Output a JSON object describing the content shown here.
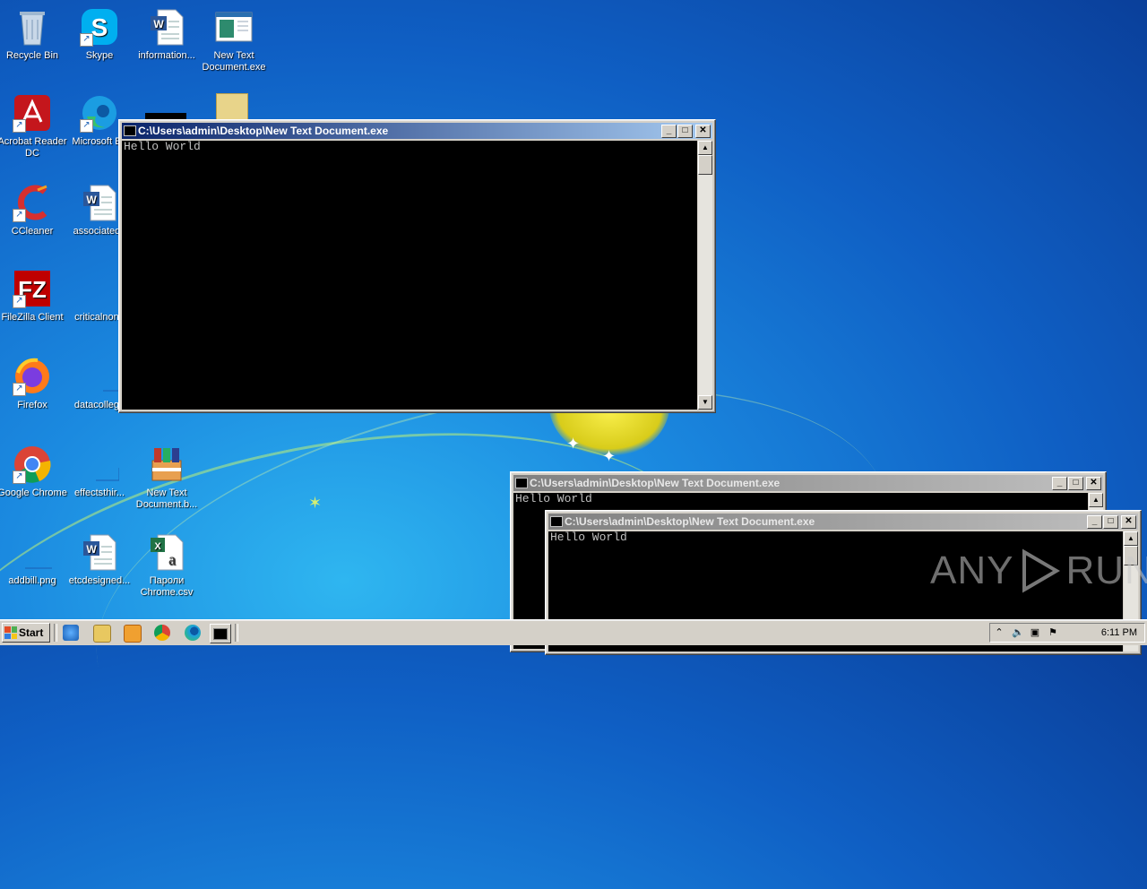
{
  "desktop": {
    "icons": [
      {
        "label": "Recycle Bin",
        "icon": "recycle-bin-icon"
      },
      {
        "label": "Skype",
        "icon": "skype-icon"
      },
      {
        "label": "information...",
        "icon": "word-document-icon"
      },
      {
        "label": "New Text Document.exe",
        "icon": "console-exe-icon"
      },
      {
        "label": "Acrobat Reader DC",
        "icon": "acrobat-icon"
      },
      {
        "label": "Microsoft Ed",
        "icon": "edge-icon"
      },
      {
        "label": "CCleaner",
        "icon": "ccleaner-icon"
      },
      {
        "label": "associateda",
        "icon": "word-document-icon"
      },
      {
        "label": "FileZilla Client",
        "icon": "filezilla-icon"
      },
      {
        "label": "criticalnone",
        "icon": "blank-file-icon"
      },
      {
        "label": "Firefox",
        "icon": "firefox-icon"
      },
      {
        "label": "datacollege",
        "icon": "blank-file-icon"
      },
      {
        "label": "Google Chrome",
        "icon": "chrome-icon"
      },
      {
        "label": "effectsthir...",
        "icon": "blank-file-icon"
      },
      {
        "label": "New Text Document.b...",
        "icon": "winrar-icon"
      },
      {
        "label": "addbill.png",
        "icon": "blank-file-icon"
      },
      {
        "label": "etcdesigned...",
        "icon": "word-document-icon"
      },
      {
        "label": "Пароли Chrome.csv",
        "icon": "excel-csv-icon"
      }
    ]
  },
  "windows": [
    {
      "title": "C:\\Users\\admin\\Desktop\\New Text Document.exe",
      "output": "Hello World",
      "state": "active"
    },
    {
      "title": "C:\\Users\\admin\\Desktop\\New Text Document.exe",
      "output": "Hello World",
      "state": "inactive"
    },
    {
      "title": "C:\\Users\\admin\\Desktop\\New Text Document.exe",
      "output": "Hello World",
      "state": "inactive"
    }
  ],
  "title_buttons": {
    "minimize": "_",
    "maximize": "□",
    "close": "✕"
  },
  "watermark": {
    "text_left": "ANY",
    "text_right": "RUN"
  },
  "taskbar": {
    "start_label": "Start",
    "quick_launch": [
      "ie-icon",
      "explorer-icon",
      "media-player-icon",
      "chrome-icon",
      "edge-icon",
      "console-icon"
    ],
    "clock": "6:11 PM",
    "tray_icons": [
      "show-hidden-icon",
      "volume-icon",
      "network-icon",
      "action-center-flag-icon"
    ]
  },
  "colors": {
    "desktop_bg": "#0f5fc4",
    "title_active": "#0a246a",
    "title_inactive": "#808080",
    "console_bg": "#000000",
    "console_text": "#c0c0c0"
  }
}
